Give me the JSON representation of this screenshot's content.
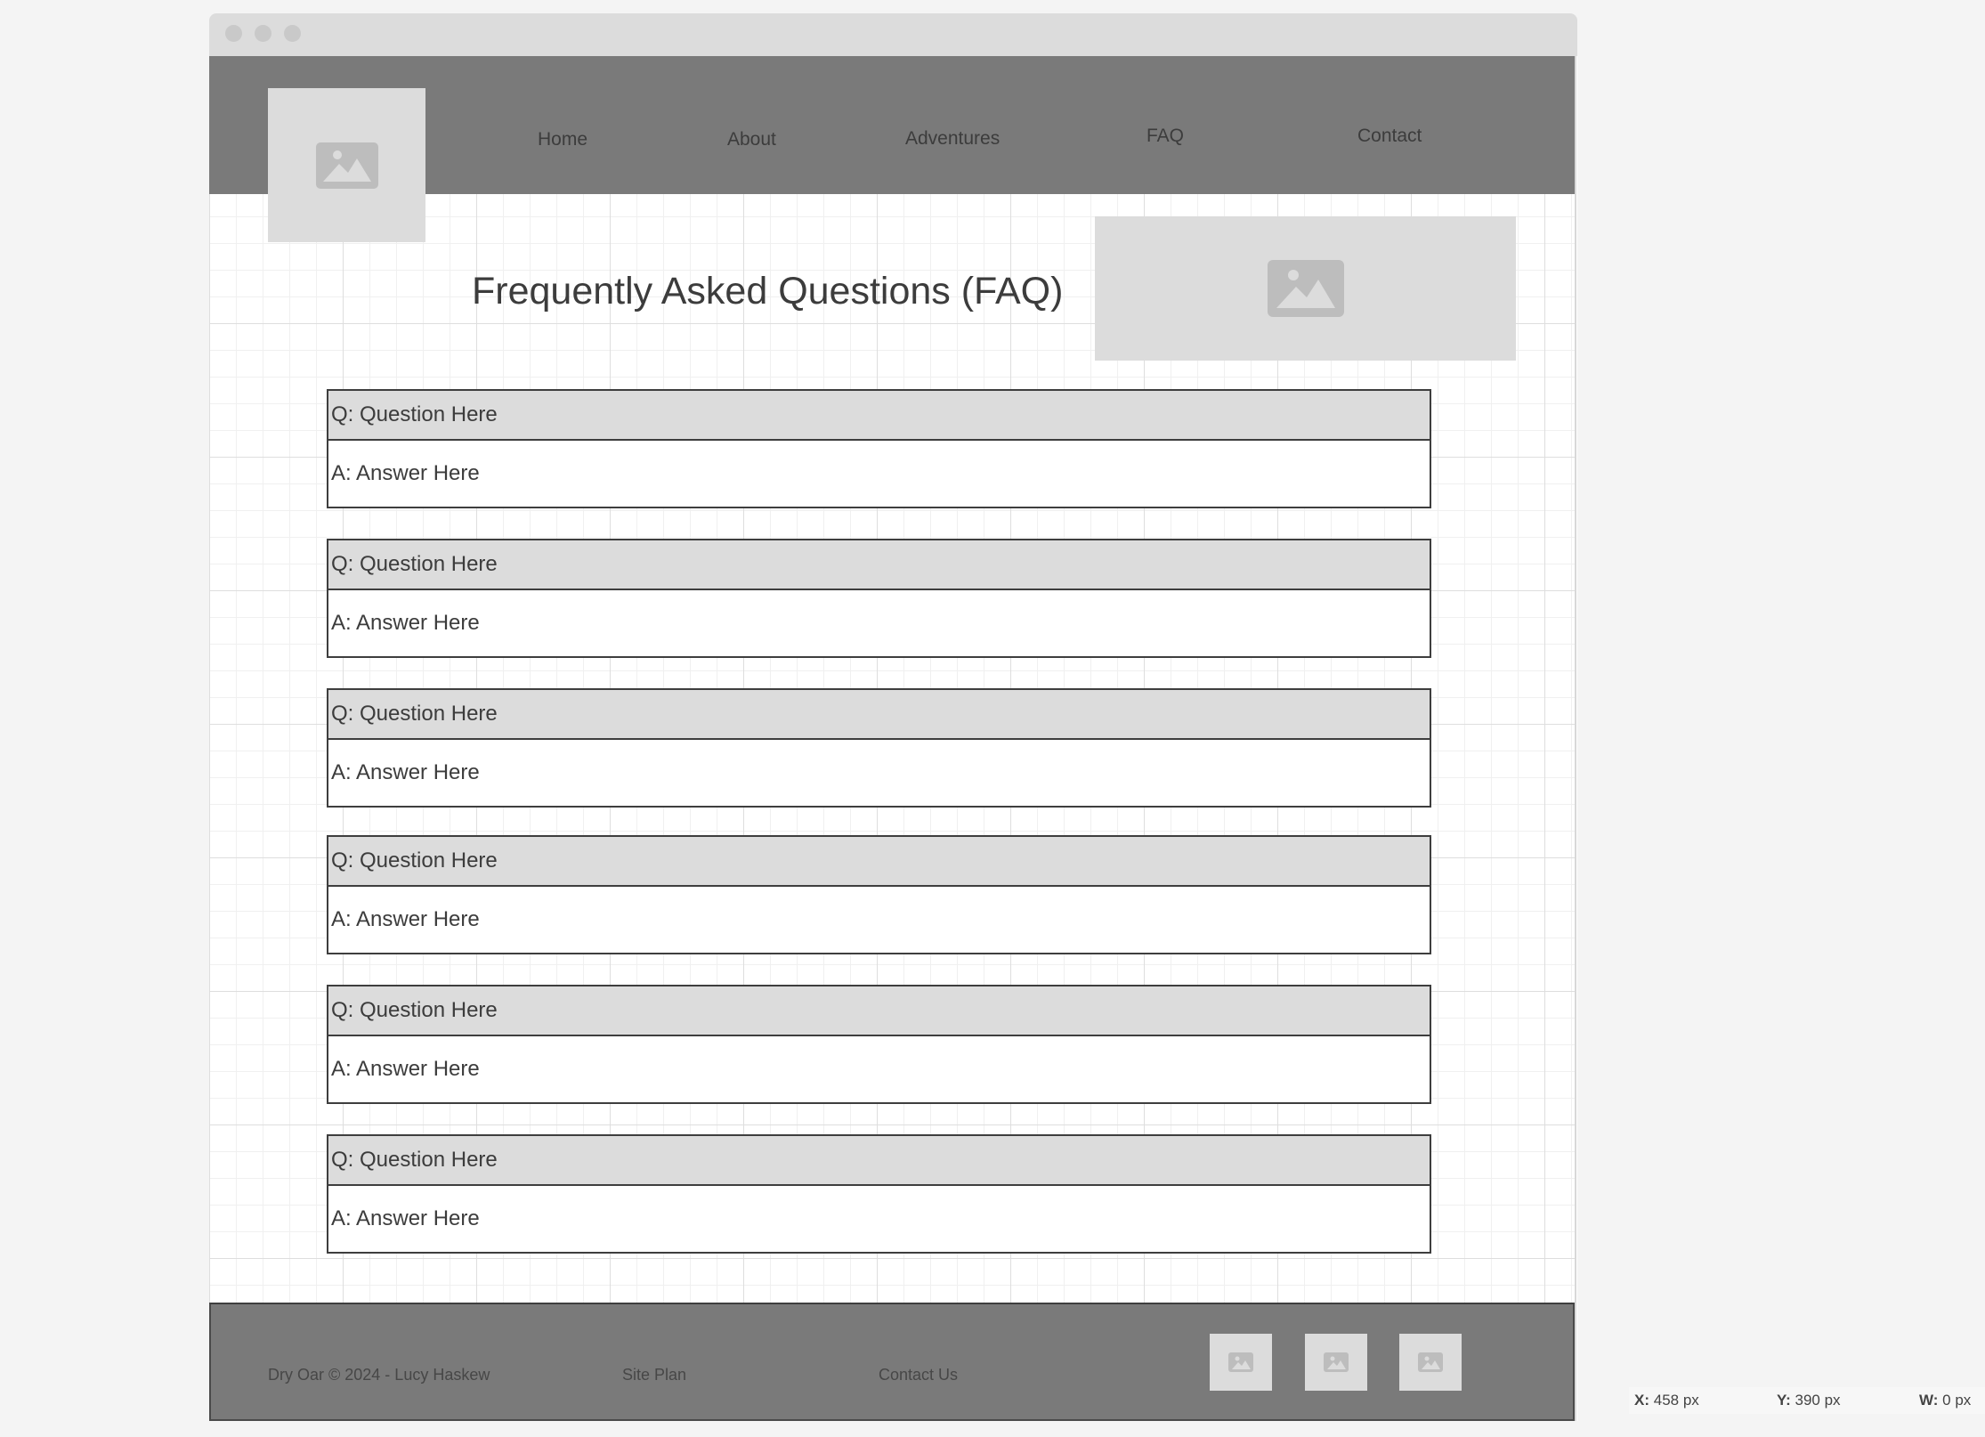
{
  "header": {
    "logo_icon": "image-placeholder-icon",
    "nav": [
      "Home",
      "About",
      "Adventures",
      "FAQ",
      "Contact"
    ]
  },
  "main": {
    "title": "Frequently Asked Questions (FAQ)",
    "hero_icon": "image-placeholder-icon",
    "faqs": [
      {
        "q": "Q: Question Here",
        "a": "A: Answer Here"
      },
      {
        "q": "Q: Question Here",
        "a": "A: Answer Here"
      },
      {
        "q": "Q: Question Here",
        "a": "A: Answer Here"
      },
      {
        "q": "Q: Question Here",
        "a": "A: Answer Here"
      },
      {
        "q": "Q: Question Here",
        "a": "A: Answer Here"
      },
      {
        "q": "Q: Question Here",
        "a": "A: Answer Here"
      }
    ]
  },
  "footer": {
    "copyright": "Dry Oar © 2024 - Lucy Haskew",
    "site_plan": "Site Plan",
    "contact_us": "Contact Us",
    "social_icons": [
      "image-placeholder-icon",
      "image-placeholder-icon",
      "image-placeholder-icon"
    ]
  },
  "readout": {
    "x_label": "X:",
    "x_value": "458 px",
    "y_label": "Y:",
    "y_value": "390 px",
    "w_label": "W:",
    "w_value": "0 px"
  },
  "colors": {
    "header_bg": "#7a7a7a",
    "placeholder_bg": "#dcdcdc",
    "border": "#3e3e3e",
    "text": "#3c3c3c"
  }
}
